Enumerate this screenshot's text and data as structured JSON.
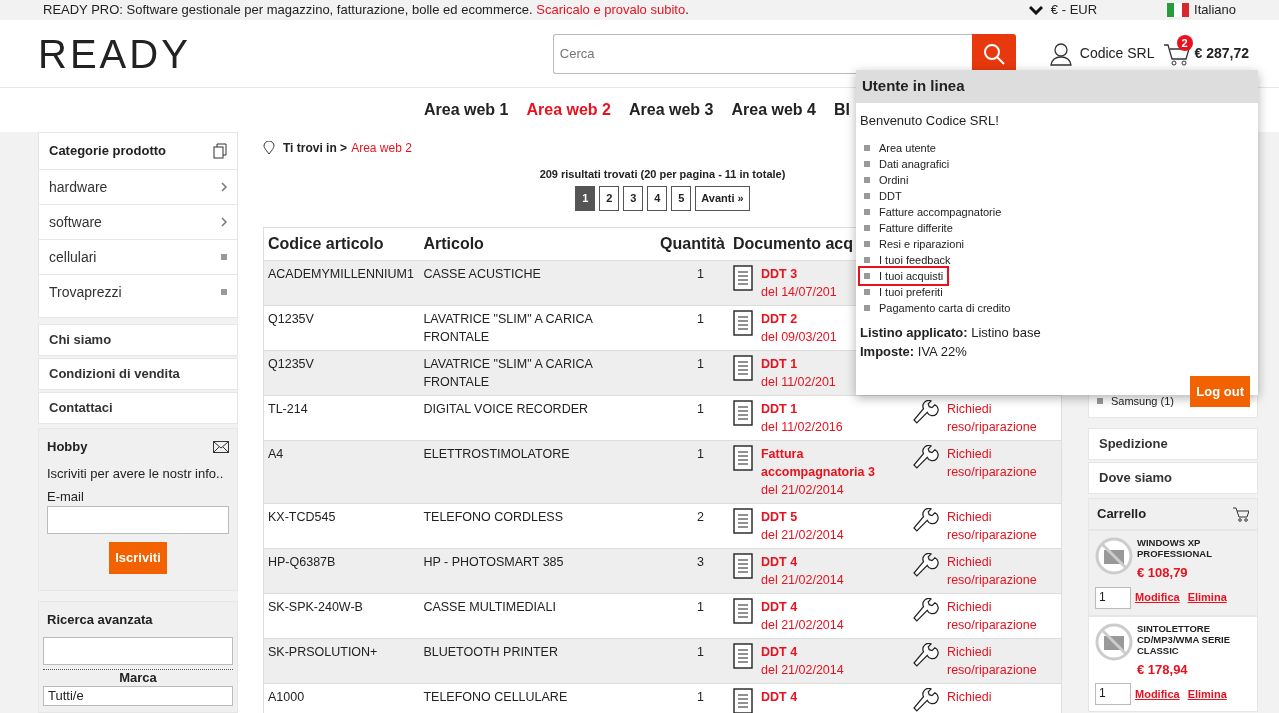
{
  "top_bar": {
    "text": "READY PRO: Software gestionale per magazzino, fatturazione, bolle ed ecommerce.",
    "link": "Scaricalo e provalo subito",
    "after": ".",
    "currency": "€ - EUR",
    "language": "Italiano"
  },
  "header": {
    "logo": "READY",
    "search": {
      "placeholder": "Cerca"
    },
    "user": "Codice SRL",
    "cart_count": "2",
    "cart_total": "€ 287,72"
  },
  "nav": [
    {
      "label": "Area web 1",
      "selected": false
    },
    {
      "label": "Area web 2",
      "selected": true
    },
    {
      "label": "Area web 3",
      "selected": false
    },
    {
      "label": "Area web 4",
      "selected": false
    },
    {
      "label": "Bl",
      "selected": false
    }
  ],
  "sidebar": {
    "categories_title": "Categorie prodotto",
    "categories": [
      {
        "label": "hardware",
        "kind": "arrow"
      },
      {
        "label": "software",
        "kind": "arrow"
      },
      {
        "label": "cellulari",
        "kind": "square"
      },
      {
        "label": "Trovaprezzi",
        "kind": "square"
      }
    ],
    "pages": [
      "Chi siamo",
      "Condizioni di vendita",
      "Contattaci"
    ],
    "newsletter": {
      "title": "Hobby",
      "text": "Iscriviti per avere le nostr info..",
      "label": "E-mail",
      "button": "Iscriviti"
    },
    "advanced_search": {
      "title": "Ricerca avanzata",
      "brand_label": "Marca",
      "brand_value": "Tutti/e"
    }
  },
  "breadcrumb": {
    "prefix": "Ti trovi in >",
    "current": "Area web 2"
  },
  "results": "209 risultati trovati (20 per pagina - 11 in totale)",
  "pagination": [
    {
      "label": "1",
      "selected": true
    },
    {
      "label": "2",
      "selected": false
    },
    {
      "label": "3",
      "selected": false
    },
    {
      "label": "4",
      "selected": false
    },
    {
      "label": "5",
      "selected": false
    },
    {
      "label": "Avanti »",
      "selected": false
    }
  ],
  "table": {
    "columns": [
      "Codice articolo",
      "Articolo",
      "Quantità",
      "Documento acq"
    ],
    "rows": [
      {
        "code": "ACADEMYMILLENNIUM1",
        "article": "CASSE ACUSTICHE",
        "qty": "1",
        "doc": "DDT 3",
        "date": "del 14/07/201"
      },
      {
        "code": "Q1235V",
        "article": "LAVATRICE \"SLIM\" A CARICA FRONTALE",
        "qty": "1",
        "doc": "DDT 2",
        "date": "del 09/03/201"
      },
      {
        "code": "Q1235V",
        "article": "LAVATRICE \"SLIM\" A CARICA FRONTALE",
        "qty": "1",
        "doc": "DDT 1",
        "date": "del 11/02/201"
      },
      {
        "code": "TL-214",
        "article": "DIGITAL VOICE RECORDER",
        "qty": "1",
        "doc": "DDT 1",
        "date": "del 11/02/2016",
        "action": "Richiedi reso/riparazione"
      },
      {
        "code": "A4",
        "article": "ELETTROSTIMOLATORE",
        "qty": "1",
        "doc": "Fattura accompagnatoria 3",
        "date": "del 21/02/2014",
        "action": "Richiedi reso/riparazione"
      },
      {
        "code": "KX-TCD545",
        "article": "TELEFONO CORDLESS",
        "qty": "2",
        "doc": "DDT 5",
        "date": "del 21/02/2014",
        "action": "Richiedi reso/riparazione"
      },
      {
        "code": "HP-Q6387B",
        "article": "HP - PHOTOSMART 385",
        "qty": "3",
        "doc": "DDT 4",
        "date": "del 21/02/2014",
        "action": "Richiedi reso/riparazione"
      },
      {
        "code": "SK-SPK-240W-B",
        "article": "CASSE MULTIMEDIALI",
        "qty": "1",
        "doc": "DDT 4",
        "date": "del 21/02/2014",
        "action": "Richiedi reso/riparazione"
      },
      {
        "code": "SK-PRSOLUTION+",
        "article": "BLUETOOTH PRINTER",
        "qty": "1",
        "doc": "DDT 4",
        "date": "del 21/02/2014",
        "action": "Richiedi reso/riparazione"
      },
      {
        "code": "A1000",
        "article": "TELEFONO CELLULARE",
        "qty": "1",
        "doc": "DDT 4",
        "action": "Richiedi"
      }
    ]
  },
  "right_sidebar": {
    "brand_item": "Samsung (1)",
    "pages": [
      "Spedizione",
      "Dove siamo"
    ],
    "cart": {
      "title": "Carrello",
      "items": [
        {
          "name": "WINDOWS XP PROFESSIONAL",
          "price": "€ 108,79",
          "qty": "1",
          "edit": "Modifica",
          "remove": "Elimina"
        },
        {
          "name": "SINTOLETTORE CD/MP3/WMA SERIE CLASSIC",
          "price": "€ 178,94",
          "qty": "1",
          "edit": "Modifica",
          "remove": "Elimina"
        }
      ]
    }
  },
  "user_popup": {
    "title": "Utente in linea",
    "welcome": "Benvenuto Codice SRL!",
    "menu": [
      {
        "label": "Area utente",
        "selected": false
      },
      {
        "label": "Dati anagrafici",
        "selected": false
      },
      {
        "label": "Ordini",
        "selected": false
      },
      {
        "label": "DDT",
        "selected": false
      },
      {
        "label": "Fatture accompagnatorie",
        "selected": false
      },
      {
        "label": "Fatture differite",
        "selected": false
      },
      {
        "label": "Resi e riparazioni",
        "selected": false
      },
      {
        "label": "I tuoi feedback",
        "selected": false
      },
      {
        "label": "I tuoi acquisti",
        "selected": true
      },
      {
        "label": "I tuoi preferiti",
        "selected": false
      },
      {
        "label": "Pagamento carta di credito",
        "selected": false
      }
    ],
    "price_list": "**Listino applicato:** Listino base",
    "taxes": "**Imposte:** IVA 22%",
    "logout": "Log out"
  }
}
